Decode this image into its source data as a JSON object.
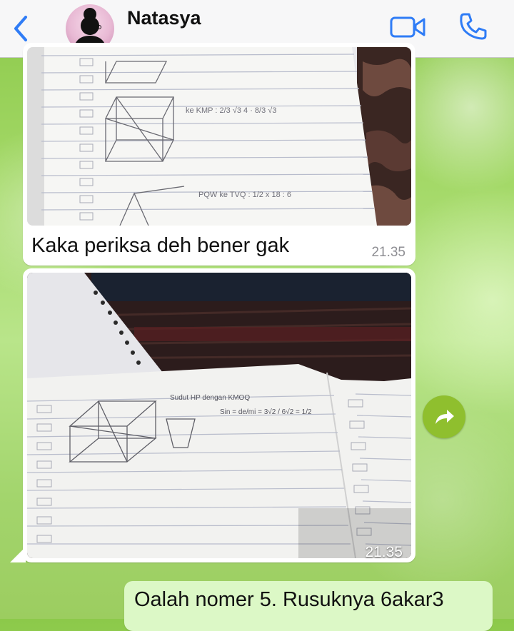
{
  "header": {
    "contact_name": "Natasya",
    "contact_status": "",
    "accent_color": "#2f7cf6",
    "icons": {
      "back": "chevron-left-icon",
      "video": "video-camera-icon",
      "call": "phone-icon"
    }
  },
  "messages": [
    {
      "type": "image",
      "direction": "incoming",
      "caption": "Kaka periksa deh bener gak",
      "time": "21.35",
      "image_description": "notebook-page-geometry"
    },
    {
      "type": "image",
      "direction": "incoming",
      "caption": "",
      "time": "21.35",
      "image_description": "notebook-on-carpet-geometry"
    },
    {
      "type": "text",
      "direction": "outgoing",
      "text": "Oalah nomer 5. Rusuknya 6akar3"
    }
  ],
  "forward": {
    "icon": "forward-arrow-icon",
    "color": "#8fbf2e"
  },
  "photo_notes": {
    "p1_line1": "ke KMP : 2/3 √3 4 · 8/3 √3",
    "p1_line2": "PQW ke TVQ : 1/2 x 18 : 6",
    "p2_line1": "Sudut HP dengan KMOQ",
    "p2_line2": "Sin = de/mi = 3√2 / 6√2 = 1/2"
  }
}
